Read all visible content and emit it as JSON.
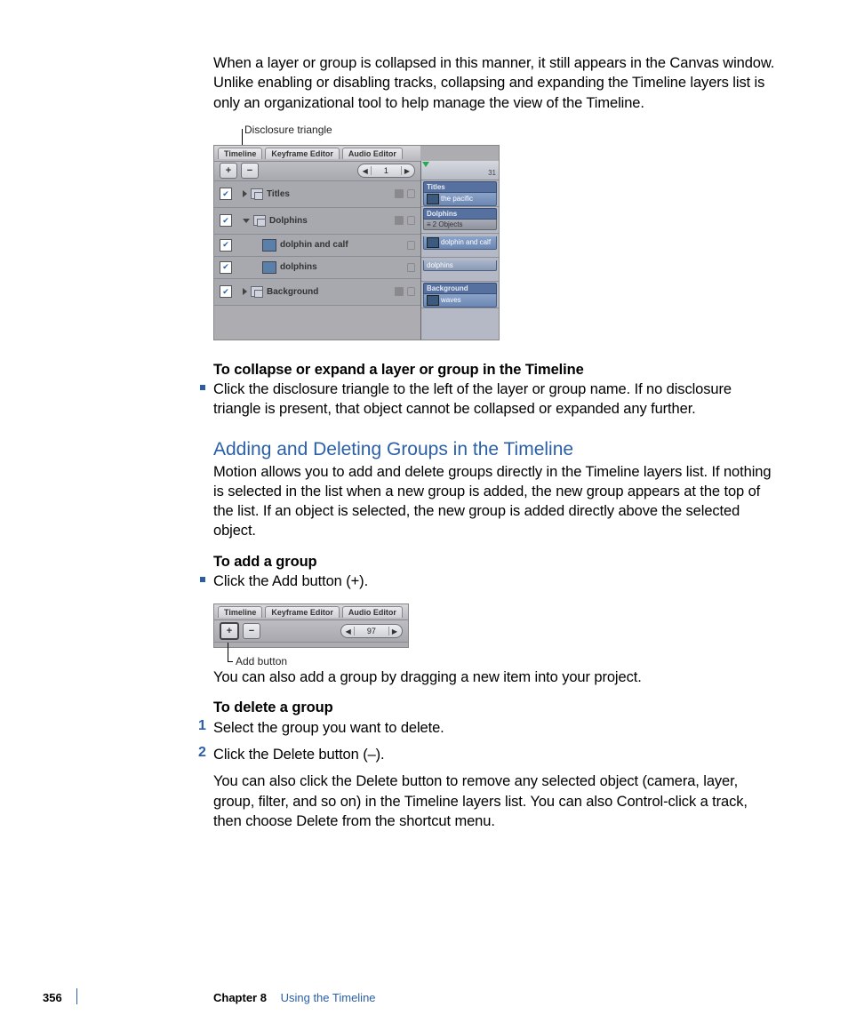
{
  "intro_para": "When a layer or group is collapsed in this manner, it still appears in the Canvas window. Unlike enabling or disabling tracks, collapsing and expanding the Timeline layers list is only an organizational tool to help manage the view of the Timeline.",
  "fig1": {
    "callout": "Disclosure triangle",
    "tabs": [
      "Timeline",
      "Keyframe Editor",
      "Audio Editor"
    ],
    "add": "+",
    "del": "−",
    "frame": "1",
    "ruler_mark": "31",
    "layers": [
      {
        "name": "Titles",
        "indent": 0,
        "tri": "right",
        "group": true
      },
      {
        "name": "Dolphins",
        "indent": 0,
        "tri": "down",
        "group": true
      },
      {
        "name": "dolphin and calf",
        "indent": 1,
        "tri": "",
        "group": false
      },
      {
        "name": "dolphins",
        "indent": 1,
        "tri": "",
        "group": false
      },
      {
        "name": "Background",
        "indent": 0,
        "tri": "right",
        "group": true
      }
    ],
    "tracks": [
      {
        "header": "Titles",
        "item": "the pacific",
        "thumb": true
      },
      {
        "header": "Dolphins",
        "item": "2 Objects",
        "gray": true
      },
      {
        "header": "",
        "item": "dolphin and calf",
        "thumb": true
      },
      {
        "header": "",
        "item": "dolphins"
      },
      {
        "header": "Background",
        "item": "waves",
        "thumb": true
      }
    ]
  },
  "collapse_heading": "To collapse or expand a layer or group in the Timeline",
  "collapse_bullet": "Click the disclosure triangle to the left of the layer or group name. If no disclosure triangle is present, that object cannot be collapsed or expanded any further.",
  "section_heading": "Adding and Deleting Groups in the Timeline",
  "section_para": "Motion allows you to add and delete groups directly in the Timeline layers list. If nothing is selected in the list when a new group is added, the new group appears at the top of the list. If an object is selected, the new group is added directly above the selected object.",
  "add_heading": "To add a group",
  "add_bullet": "Click the Add button (+).",
  "fig2": {
    "tabs": [
      "Timeline",
      "Keyframe Editor",
      "Audio Editor"
    ],
    "add": "+",
    "del": "−",
    "frame": "97",
    "callout": "Add button"
  },
  "add_para2": "You can also add a group by dragging a new item into your project.",
  "delete_heading": "To delete a group",
  "delete_steps": [
    "Select the group you want to delete.",
    "Click the Delete button (–)."
  ],
  "delete_para": "You can also click the Delete button to remove any selected object (camera, layer, group, filter, and so on) in the Timeline layers list. You can also Control-click a track, then choose Delete from the shortcut menu.",
  "footer": {
    "page": "356",
    "chapter": "Chapter 8",
    "title": "Using the Timeline"
  }
}
